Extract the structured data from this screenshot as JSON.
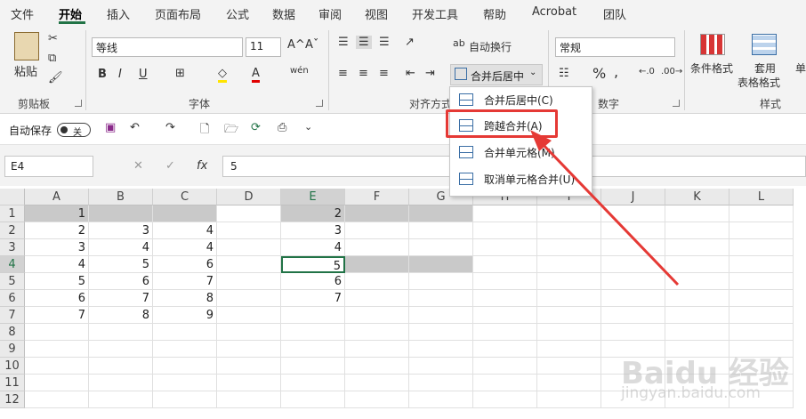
{
  "menu": {
    "tabs": [
      "文件",
      "开始",
      "插入",
      "页面布局",
      "公式",
      "数据",
      "审阅",
      "视图",
      "开发工具",
      "帮助",
      "Acrobat",
      "团队"
    ],
    "active": "开始"
  },
  "ribbon": {
    "clipboard": {
      "paste": "粘贴",
      "label": "剪贴板"
    },
    "font": {
      "name": "等线",
      "size": "11",
      "grow": "A^",
      "shrink": "Aˇ",
      "bold": "B",
      "italic": "I",
      "underline": "U",
      "phonetic": "wén",
      "label": "字体"
    },
    "align": {
      "wrap": "自动换行",
      "merge": "合并后居中",
      "label": "对齐方式"
    },
    "number": {
      "format": "常规",
      "percent": "%",
      "comma": ",",
      "label": "数字"
    },
    "styles": {
      "cond": "条件格式",
      "table1": "套用",
      "table2": "表格格式",
      "cell": "单",
      "label": "样式"
    }
  },
  "qat": {
    "autosave": "自动保存",
    "toggle": "关"
  },
  "formula_bar": {
    "name_box": "E4",
    "cancel": "✕",
    "enter": "✓",
    "fx": "fx",
    "value": "5"
  },
  "columns": [
    "A",
    "B",
    "C",
    "D",
    "E",
    "F",
    "G",
    "H",
    "I",
    "J",
    "K",
    "L"
  ],
  "rows": [
    "1",
    "2",
    "3",
    "4",
    "5",
    "6",
    "7",
    "8",
    "9",
    "10",
    "11",
    "12"
  ],
  "cells": {
    "A": [
      "1",
      "2",
      "3",
      "4",
      "5",
      "6",
      "7",
      "",
      "",
      "",
      "",
      ""
    ],
    "B": [
      "",
      "3",
      "4",
      "5",
      "6",
      "7",
      "8",
      "",
      "",
      "",
      "",
      ""
    ],
    "C": [
      "",
      "4",
      "4",
      "6",
      "7",
      "8",
      "9",
      "",
      "",
      "",
      "",
      ""
    ],
    "E": [
      "2",
      "3",
      "4",
      "5",
      "6",
      "7",
      "",
      "",
      "",
      "",
      "",
      ""
    ]
  },
  "merge_menu": {
    "items": [
      "合并后居中(C)",
      "跨越合并(A)",
      "合并单元格(M)",
      "取消单元格合并(U)"
    ],
    "highlighted": "跨越合并(A)"
  },
  "watermark": {
    "line1": "Baidu 经验",
    "line2": "jingyan.baidu.com"
  },
  "colors": {
    "accent": "#217346",
    "highlight": "#e53935",
    "selected_fill": "#c9c9c9"
  }
}
